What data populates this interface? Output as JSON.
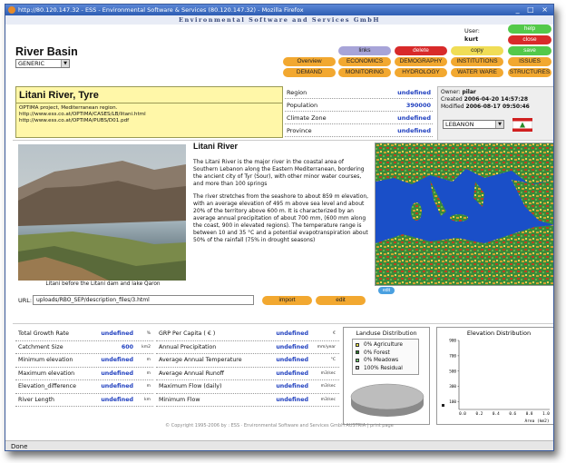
{
  "window": {
    "title": "http://80.120.147.32 - ESS - Environmental Software & Services (80.120.147.32) - Mozilla Firefox",
    "controls": "_ □ ×"
  },
  "header": {
    "company": "Environmental Software and Services GmbH"
  },
  "page": {
    "title": "River Basin",
    "type_select": "GENERIC"
  },
  "user": {
    "label": "User:",
    "name": "kurt"
  },
  "buttons": {
    "help": "help",
    "close": "close",
    "links": "links",
    "delete": "delete",
    "copy": "copy",
    "save": "save",
    "overview": "Overview",
    "economics": "ECONOMICS",
    "demography": "DEMOGRAPHY",
    "institutions": "INSTITUTIONS",
    "issues": "ISSUES",
    "demand": "DEMAND",
    "monitoring": "MONITORING",
    "hydrology": "HYDROLOGY",
    "waterware": "WATER WARE",
    "structures": "STRUCTURES",
    "import": "import",
    "edit": "edit",
    "edit_map": "edit"
  },
  "basin": {
    "name": "Litani River, Tyre",
    "line1": "OPTIMA project, Mediterranean region.",
    "line2": "http://www.ess.co.at/OPTIMA/CASES/LB/litani.html",
    "line3": "http://www.ess.co.at/OPTIMA/PUBS/D01.pdf"
  },
  "attributes": [
    {
      "label": "Region",
      "value": "undefined"
    },
    {
      "label": "Population",
      "value": "390000"
    },
    {
      "label": "Climate Zone",
      "value": "undefined"
    },
    {
      "label": "Province",
      "value": "undefined"
    }
  ],
  "owner": {
    "owner_label": "Owner:",
    "owner": "pilar",
    "created_label": "Created",
    "created": "2006-04-20 14:57:28",
    "modified_label": "Modified",
    "modified": "2006-08-17 09:50:46",
    "country": "LEBANON"
  },
  "photo_caption": "Litani before the Litani dam and lake Qaron",
  "description": {
    "title": "Litani River",
    "p1": "The Litani River is the major river in the coastal area of Southern Lebanon along the Eastern Mediterranean, bordering the ancient city of Tyr (Sour), with other minor water courses, and more than 100 springs",
    "p2": "The river stretches from the seashore to about 859 m elevation, with an average elevation of 495 m above sea level and about 20% of the territory above 600 m. It is characterized by an average annual precipitation of about 700 mm, (600 mm along the coast, 900 in elevated regions). The temperature range is between 10 and 35 °C and a potential evapotranspiration about 50% of the rainfall (75% in drought seasons)"
  },
  "url": {
    "label": "URL:",
    "value": "uploads/RBO_SEP/description_files/3.html"
  },
  "table_left": [
    {
      "label": "Total Growth Rate",
      "value": "undefined",
      "unit": "%"
    },
    {
      "label": "Catchment Size",
      "value": "600",
      "unit": "km2"
    },
    {
      "label": "Minimum elevation",
      "value": "undefined",
      "unit": "m"
    },
    {
      "label": "Maximum elevation",
      "value": "undefined",
      "unit": "m"
    },
    {
      "label": "Elevation_difference",
      "value": "undefined",
      "unit": "m"
    },
    {
      "label": "River Length",
      "value": "undefined",
      "unit": "km"
    }
  ],
  "table_right": [
    {
      "label": "GRP Per Capita ( € )",
      "value": "undefined",
      "unit": "€"
    },
    {
      "label": "Annual Precipitation",
      "value": "undefined",
      "unit": "mm/year"
    },
    {
      "label": "Average Annual Temperature",
      "value": "undefined",
      "unit": "°C"
    },
    {
      "label": "Average Annual Runoff",
      "value": "undefined",
      "unit": "m3/sec"
    },
    {
      "label": "Maximum Flow (daily)",
      "value": "undefined",
      "unit": "m3/sec"
    },
    {
      "label": "Minimum Flow",
      "value": "undefined",
      "unit": "m3/sec"
    }
  ],
  "landuse": {
    "title": "Landuse Distribution",
    "items": [
      {
        "label": "0% Agriculture",
        "color": "#e8e24a"
      },
      {
        "label": "0% Forest",
        "color": "#2a7a2a"
      },
      {
        "label": "0% Meadows",
        "color": "#6cc46c"
      },
      {
        "label": "100% Residual",
        "color": "#bdbdbd"
      }
    ]
  },
  "chart_data": {
    "type": "line",
    "title": "Elevation Distribution",
    "xlabel": "Area (km2)",
    "ylabel": "",
    "x_ticks": [
      "0.0",
      "0.2",
      "0.4",
      "0.6",
      "0.8",
      "1.0"
    ],
    "y_ticks": [
      "900",
      "700",
      "500",
      "300",
      "100"
    ],
    "xlim": [
      0,
      1
    ],
    "ylim": [
      0,
      900
    ],
    "series": []
  },
  "footer": "© Copyright 1995-2006 by : ESS · Environmental Software and Services GmbH AUSTRIA | print page",
  "status": "Done"
}
